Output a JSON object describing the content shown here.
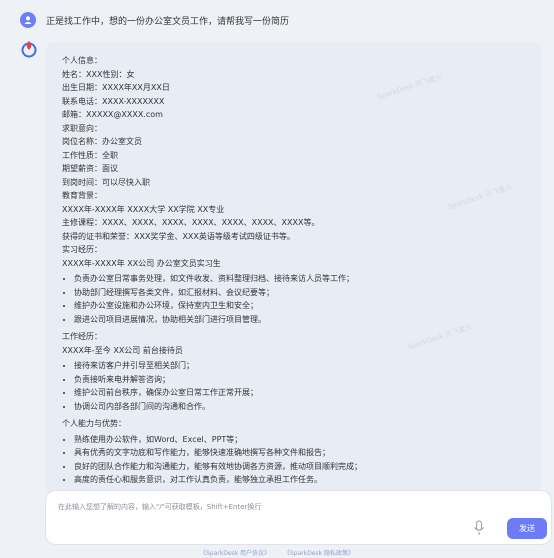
{
  "conversation": {
    "user_message": "正是找工作中，想的一份办公室文员工作，请帮我写一份简历"
  },
  "answer": {
    "personal_header": "个人信息：",
    "personal": [
      "姓名：XXX性别：女",
      "出生日期：XXXX年XX月XX日",
      "联系电话：XXXX-XXXXXXX",
      "邮箱：XXXXX@XXXX.com"
    ],
    "intent_header": "求职意向：",
    "intent": [
      "岗位名称：办公室文员",
      "工作性质：全职",
      "期望薪资：面议",
      "到岗时间：可以尽快入职"
    ],
    "edu_header": "教育背景：",
    "edu": [
      "XXXX年-XXXX年 XXXX大学 XX学院 XX专业",
      "主修课程：XXXX、XXXX、XXXX、XXXX、XXXX、XXXX、XXXX等。",
      "获得的证书和荣誉：XXX奖学金、XXX英语等级考试四级证书等。"
    ],
    "intern_header": "实习经历：",
    "intern_title": "XXXX年-XXXX年 XX公司 办公室文员实习生",
    "intern_items": [
      "负责办公室日常事务处理，如文件收发、资料整理归档、接待来访人员等工作；",
      "协助部门经理撰写各类文件，如汇报材料、会议纪要等；",
      "维护办公室设施和办公环境，保持室内卫生和安全；",
      "跟进公司项目进展情况，协助相关部门进行项目管理。"
    ],
    "work_header": "工作经历：",
    "work_title": "XXXX年-至今 XX公司 前台接待员",
    "work_items": [
      "接待来访客户并引导至相关部门；",
      "负责接听来电并解答咨询；",
      "维护公司前台秩序，确保办公室日常工作正常开展；",
      "协调公司内部各部门间的沟通和合作。"
    ],
    "ability_header": "个人能力与优势：",
    "ability_items": [
      "熟练使用办公软件，如Word、Excel、PPT等；",
      "具有优秀的文字功底和写作能力，能够快速准确地撰写各种文件和报告；",
      "良好的团队合作能力和沟通能力，能够有效地协调各方资源，推动项目顺利完成；",
      "高度的责任心和服务意识，对工作认真负责，能够独立承担工作任务。"
    ]
  },
  "input": {
    "placeholder": "在此输入您想了解的内容，输入\"/\"可获取模板，Shift+Enter换行",
    "send_label": "发送"
  },
  "footer": {
    "links": [
      "《SparkDesk 用户协议》",
      "《SparkDesk 隐私政策》"
    ]
  },
  "colors": {
    "accent": "#6b7cf6",
    "background": "#eef1f6",
    "card": "#e8ecf5"
  }
}
